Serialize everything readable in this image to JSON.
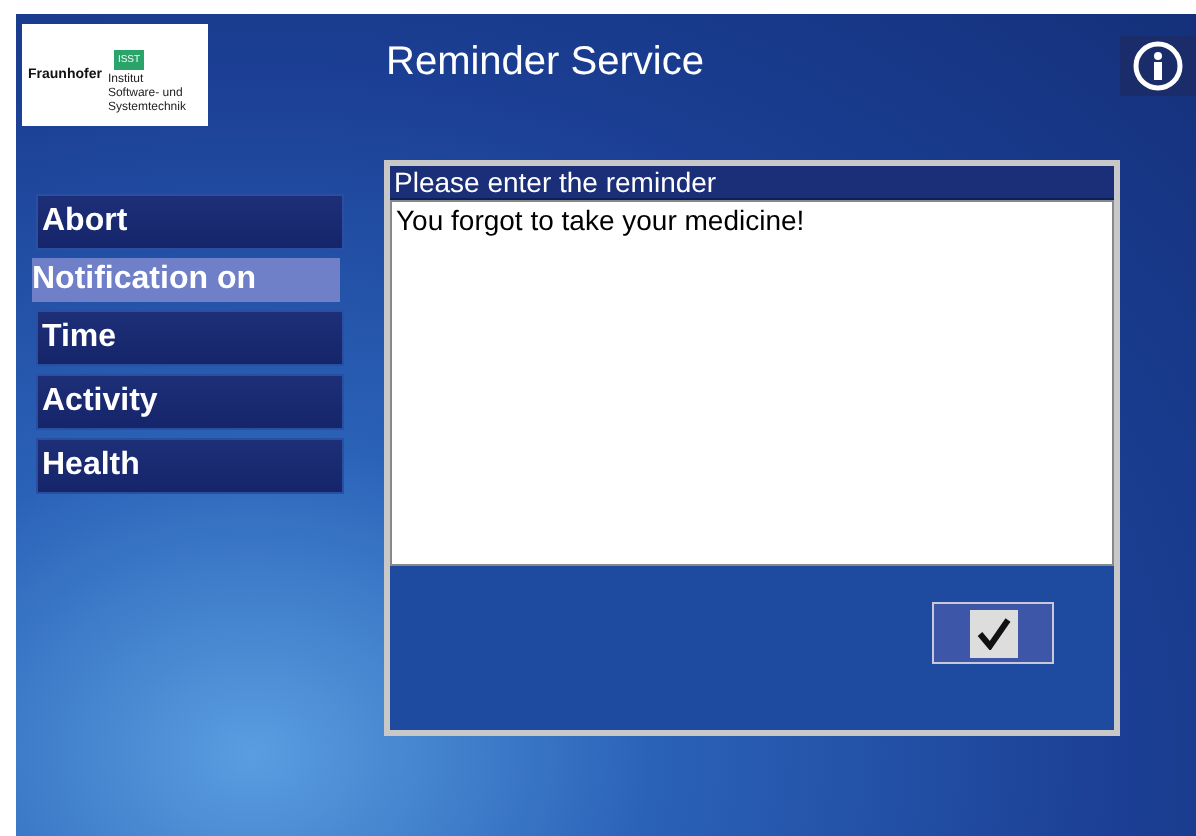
{
  "logo": {
    "wordmark": "Fraunhofer",
    "badge": "ISST",
    "institute": [
      "Institut",
      "Software- und",
      "Systemtechnik"
    ]
  },
  "title": "Reminder Service",
  "menu": [
    {
      "label": "Abort",
      "selected": false
    },
    {
      "label": "Notification on",
      "selected": true
    },
    {
      "label": "Time",
      "selected": false
    },
    {
      "label": "Activity",
      "selected": false
    },
    {
      "label": "Health",
      "selected": false
    }
  ],
  "reminder": {
    "label": "Please enter the reminder",
    "value": "You forgot to take your medicine!"
  }
}
